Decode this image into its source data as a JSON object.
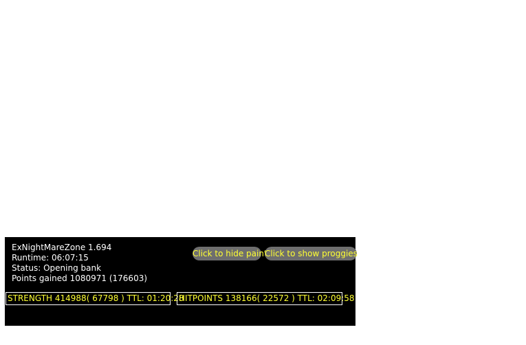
{
  "paint": {
    "title": "ExNightMareZone 1.694",
    "runtime": "Runtime: 06:07:15",
    "status": "Status: Opening bank",
    "points": "Points gained 1080971 (176603)"
  },
  "buttons": {
    "hide_paint": "Click to hide paint",
    "show_proggies": "Click to show proggies"
  },
  "skills": [
    {
      "label": "STRENGTH  414988( 67798 )  TTL: 01:20:28"
    },
    {
      "label": "HITPOINTS  138166( 22572 )  TTL: 02:09:58"
    }
  ],
  "colors": {
    "panel_bg": "#000000",
    "text_primary": "#ffffff",
    "text_accent": "#ffff33",
    "button_bg": "#6e6e6e"
  }
}
